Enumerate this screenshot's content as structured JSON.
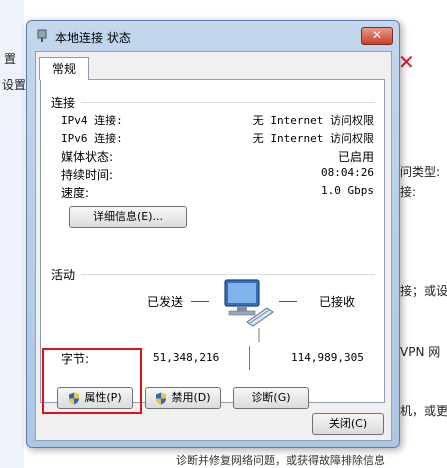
{
  "background": {
    "left_fragments": [
      "置",
      "设置"
    ],
    "right_fragments": [
      "问类型:",
      "接:",
      "接；或设",
      "VPN 网",
      "机，或更"
    ],
    "bottom_fragments": [
      "诊断并修复网络问题，或获得故障排除信息"
    ]
  },
  "window": {
    "title": "本地连接 状态",
    "close_label": "✕"
  },
  "tab": {
    "label": "常规"
  },
  "connection": {
    "section_title": "连接",
    "rows": [
      {
        "label": "IPv4 连接:",
        "value": "无 Internet 访问权限"
      },
      {
        "label": "IPv6 连接:",
        "value": "无 Internet 访问权限"
      },
      {
        "label": "媒体状态:",
        "value": "已启用"
      },
      {
        "label": "持续时间:",
        "value": "08:04:26"
      },
      {
        "label": "速度:",
        "value": "1.0 Gbps"
      }
    ],
    "details_button": "详细信息(E)..."
  },
  "activity": {
    "section_title": "活动",
    "sent_label": "已发送",
    "received_label": "已接收",
    "bytes_label": "字节:",
    "bytes_sent": "51,348,216",
    "bytes_received": "114,989,305"
  },
  "buttons": {
    "properties": "属性(P)",
    "disable": "禁用(D)",
    "diagnose": "诊断(G)",
    "close": "关闭(C)"
  },
  "colors": {
    "highlight_box": "#e0101a",
    "title_bar": "#c3d6ec",
    "close_button": "#c8412a"
  }
}
